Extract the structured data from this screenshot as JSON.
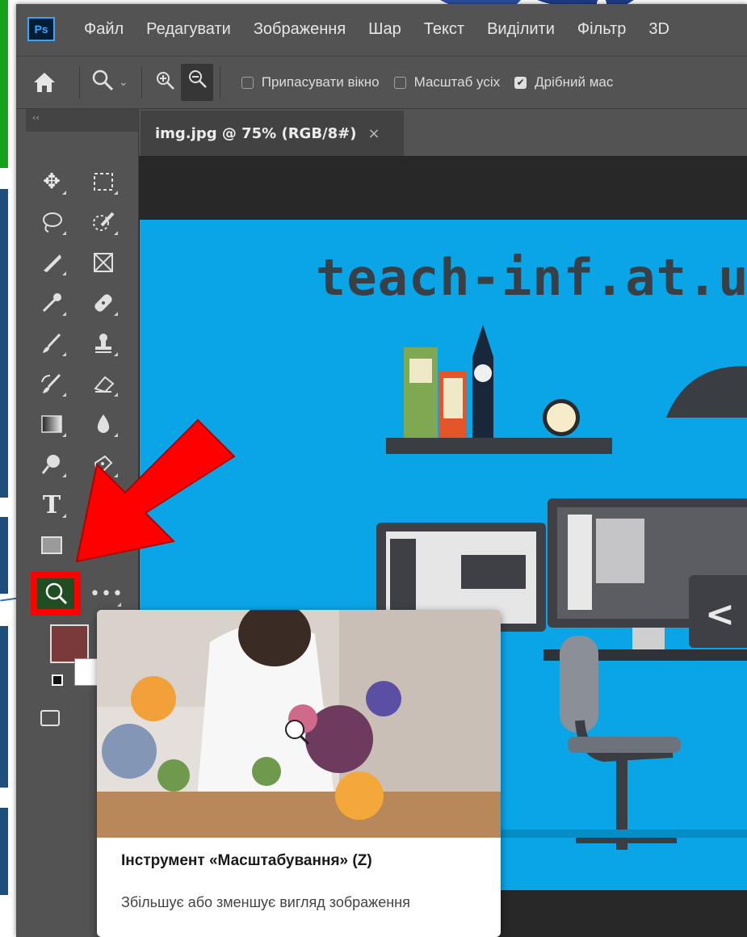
{
  "menubar": {
    "logo": "Ps",
    "items": [
      "Файл",
      "Редагувати",
      "Зображення",
      "Шар",
      "Текст",
      "Виділити",
      "Фільтр",
      "3D"
    ]
  },
  "options": {
    "checkbox1": "Припасувати вікно",
    "checkbox2": "Масштаб усіх",
    "checkbox3": "Дрібний мас"
  },
  "tools_header": "‹‹",
  "document": {
    "tab_title": "img.jpg @ 75% (RGB/8#)",
    "close": "×",
    "canvas_text": "teach-inf.at.ua"
  },
  "tooltip": {
    "title": "Інструмент «Масштабування» (Z)",
    "description": "Збільшує або зменшує вигляд зображення"
  },
  "colors": {
    "foreground": "#7b3a3a",
    "background": "#ffffff",
    "highlight": "#ff0000",
    "canvas": "#0aa5e6"
  }
}
